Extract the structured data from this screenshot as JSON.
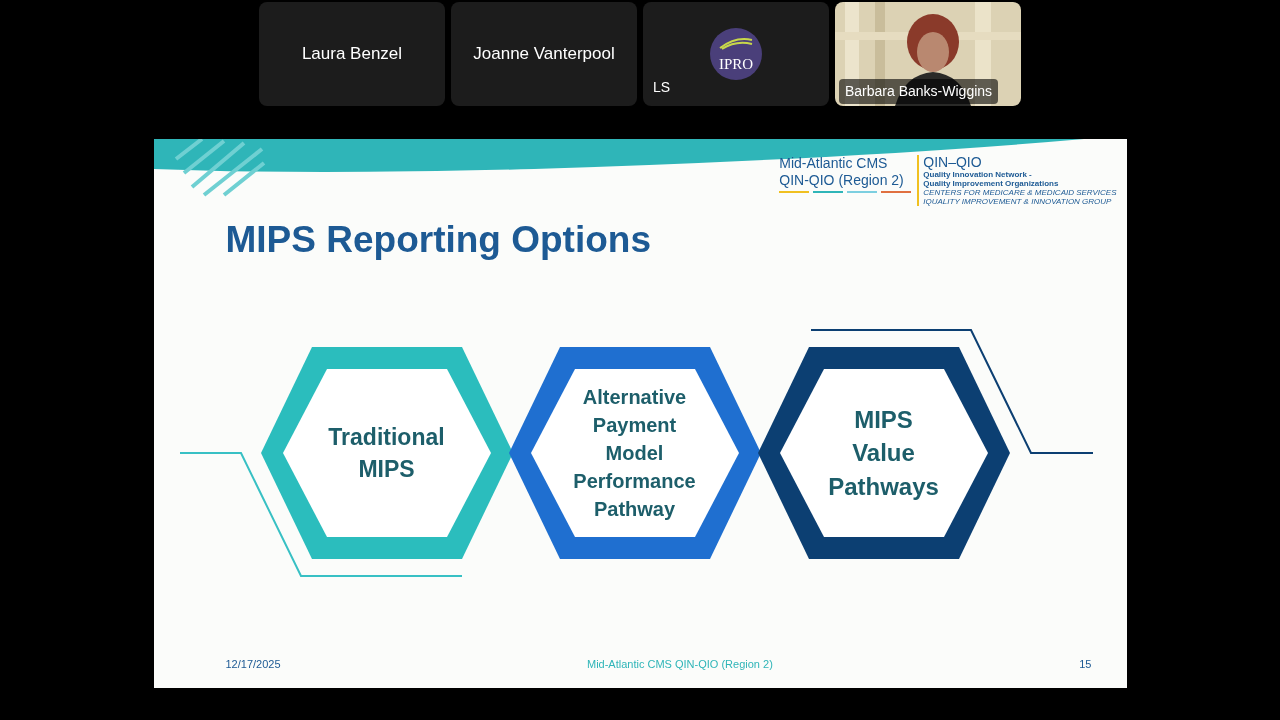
{
  "participants": [
    {
      "name": "Laura Benzel",
      "kind": "name"
    },
    {
      "name": "Joanne Vanterpool",
      "kind": "name"
    },
    {
      "name": "LS",
      "kind": "logo",
      "logo_text": "IPRO"
    },
    {
      "name": "Barbara Banks-Wiggins",
      "kind": "video"
    }
  ],
  "slide": {
    "logo": {
      "line1": "Mid-Atlantic CMS",
      "line2": "QIN-QIO (Region 2)",
      "mark": "QIN–QIO",
      "sub1": "Quality Innovation Network -",
      "sub2": "Quality Improvement Organizations",
      "sub3": "CENTERS FOR MEDICARE & MEDICAID SERVICES",
      "sub4": "IQUALITY IMPROVEMENT & INNOVATION GROUP"
    },
    "title": "MIPS Reporting Options",
    "hexagons": [
      {
        "label": "Traditional MIPS",
        "color": "#2bbdbd"
      },
      {
        "label": "Alternative Payment Model Performance Pathway",
        "color": "#1f6fd0"
      },
      {
        "label": "MIPS Value Pathways",
        "color": "#0c3f72"
      }
    ],
    "footer": {
      "date": "12/17/2025",
      "center": "Mid-Atlantic CMS QIN-QIO (Region 2)",
      "page": "15"
    }
  }
}
